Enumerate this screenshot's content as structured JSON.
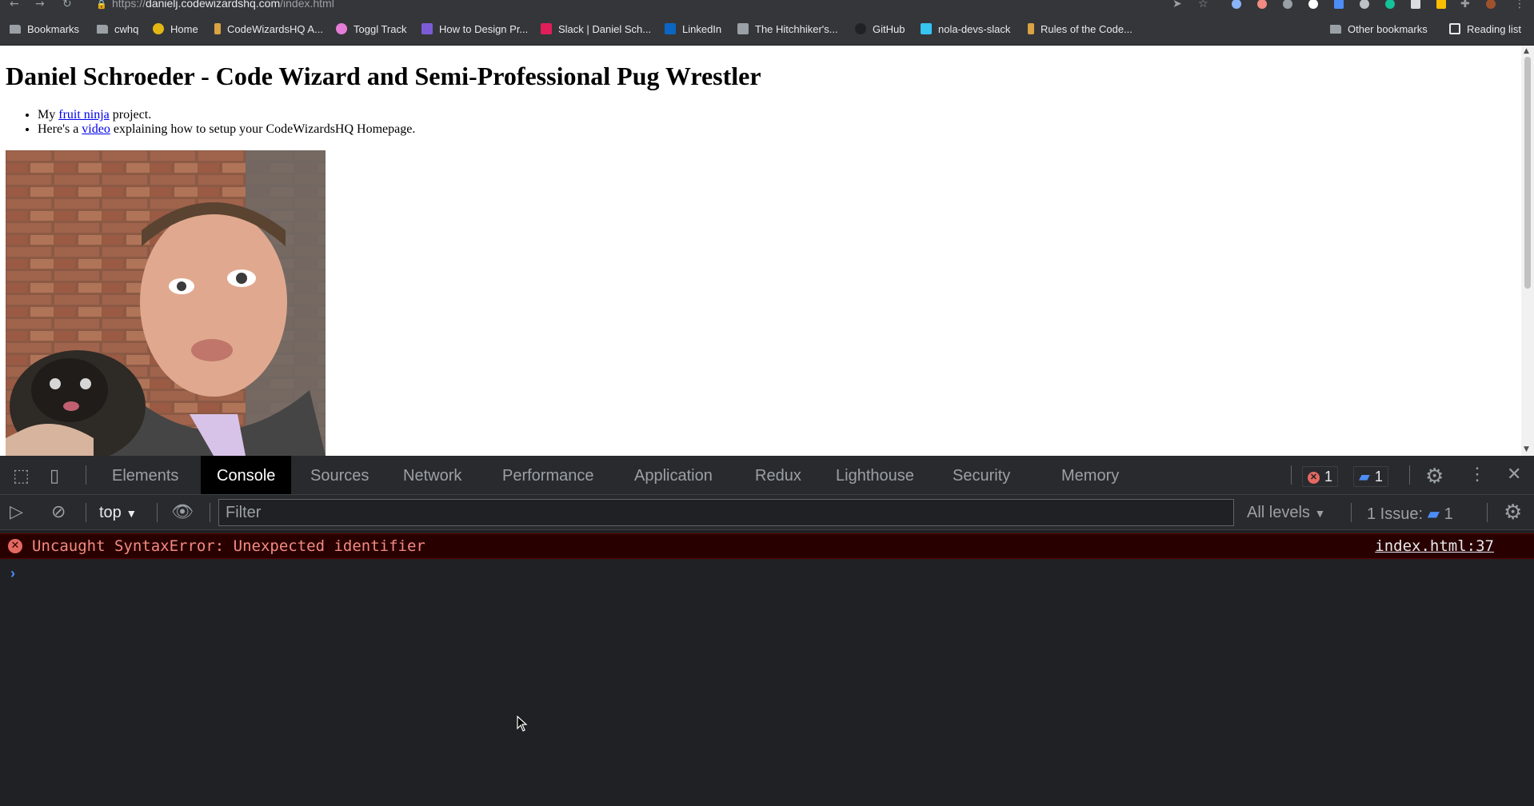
{
  "browser": {
    "url_host": "danielj.codewizardshq.com",
    "url_path": "/index.html",
    "url_prefix": "https://",
    "bookmarks": [
      {
        "label": "Bookmarks",
        "icon": "folder-icon"
      },
      {
        "label": "cwhq",
        "icon": "folder-icon"
      },
      {
        "label": "Home",
        "icon": "home-favicon"
      },
      {
        "label": "CodeWizardsHQ A...",
        "icon": "codewizards-favicon"
      },
      {
        "label": "Toggl Track",
        "icon": "toggl-favicon"
      },
      {
        "label": "How to Design Pr...",
        "icon": "htdp-favicon"
      },
      {
        "label": "Slack | Daniel Sch...",
        "icon": "slack-favicon"
      },
      {
        "label": "LinkedIn",
        "icon": "linkedin-favicon"
      },
      {
        "label": "The Hitchhiker's...",
        "icon": "hitchhiker-favicon"
      },
      {
        "label": "GitHub",
        "icon": "github-favicon"
      },
      {
        "label": "nola-devs-slack",
        "icon": "slack-favicon"
      },
      {
        "label": "Rules of the Code...",
        "icon": "codewizards-favicon"
      }
    ],
    "other_bookmarks": "Other bookmarks",
    "reading_list": "Reading list"
  },
  "page": {
    "heading": "Daniel Schroeder - Code Wizard and Semi-Professional Pug Wrestler",
    "items": [
      {
        "before": "My ",
        "link": "fruit ninja",
        "after": " project."
      },
      {
        "before": "Here's a ",
        "link": "video",
        "after": " explaining how to setup your CodeWizardsHQ Homepage."
      }
    ]
  },
  "devtools": {
    "tabs": [
      "Elements",
      "Console",
      "Sources",
      "Network",
      "Performance",
      "Application",
      "Redux",
      "Lighthouse",
      "Security",
      "Memory"
    ],
    "active_tab": "Console",
    "error_count": "1",
    "message_count": "1",
    "context": "top",
    "filter_placeholder": "Filter",
    "levels": "All levels",
    "issues_label": "1 Issue:",
    "issues_count": "1",
    "error_message": "Uncaught SyntaxError: Unexpected identifier",
    "error_source": "index.html:37",
    "colors": {
      "error_bg": "#290000",
      "error_text": "#f28b82",
      "accent": "#4c8df6"
    }
  }
}
